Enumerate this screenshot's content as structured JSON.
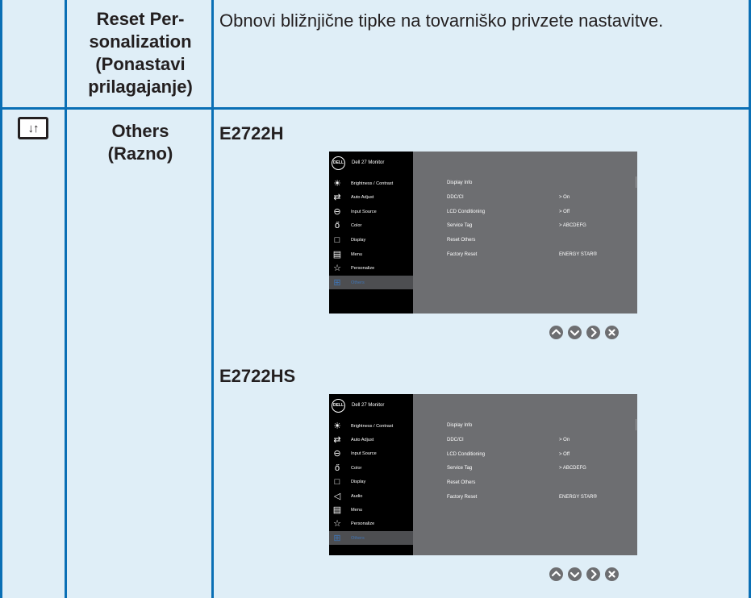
{
  "row1": {
    "name": [
      "Reset Per-",
      "sonalization",
      "(Ponastavi",
      "prilagajanje)"
    ],
    "description": "Obnovi bližnjične tipke na tovarniško privzete nastavitve."
  },
  "row2": {
    "icon": "others-sliders-icon",
    "name": [
      "Others",
      "(Razno)"
    ]
  },
  "models": [
    {
      "name": "E2722H",
      "osd": {
        "title": "Dell 27 Monitor",
        "menu": [
          {
            "icon": "brightness-icon",
            "glyph": "☀",
            "label": "Brightness / Contrast"
          },
          {
            "icon": "auto-adjust-icon",
            "glyph": "⇄",
            "label": "Auto Adjust"
          },
          {
            "icon": "input-source-icon",
            "glyph": "⊖",
            "label": "Input Source"
          },
          {
            "icon": "color-icon",
            "glyph": "ő",
            "label": "Color"
          },
          {
            "icon": "display-icon",
            "glyph": "□",
            "label": "Display"
          },
          {
            "icon": "menu-icon",
            "glyph": "▤",
            "label": "Menu"
          },
          {
            "icon": "personalize-icon",
            "glyph": "☆",
            "label": "Personalize"
          },
          {
            "icon": "others-icon",
            "glyph": "⊞",
            "label": "Others"
          }
        ],
        "items": [
          "Display Info",
          "DDC/CI",
          "LCD Conditioning",
          "Service Tag",
          "Reset Others",
          "Factory Reset"
        ],
        "values": [
          "",
          "> On",
          "> Off",
          "> ABCDEFG",
          "",
          "ENERGY STAR®"
        ]
      }
    },
    {
      "name": "E2722HS",
      "osd": {
        "title": "Dell 27 Monitor",
        "menu": [
          {
            "icon": "brightness-icon",
            "glyph": "☀",
            "label": "Brightness / Contrast"
          },
          {
            "icon": "auto-adjust-icon",
            "glyph": "⇄",
            "label": "Auto Adjust"
          },
          {
            "icon": "input-source-icon",
            "glyph": "⊖",
            "label": "Input Source"
          },
          {
            "icon": "color-icon",
            "glyph": "ő",
            "label": "Color"
          },
          {
            "icon": "display-icon",
            "glyph": "□",
            "label": "Display"
          },
          {
            "icon": "audio-icon",
            "glyph": "◁",
            "label": "Audio"
          },
          {
            "icon": "menu-icon",
            "glyph": "▤",
            "label": "Menu"
          },
          {
            "icon": "personalize-icon",
            "glyph": "☆",
            "label": "Personalize"
          },
          {
            "icon": "others-icon",
            "glyph": "⊞",
            "label": "Others"
          }
        ],
        "items": [
          "Display Info",
          "DDC/CI",
          "LCD Conditioning",
          "Service Tag",
          "Reset Others",
          "Factory Reset"
        ],
        "values": [
          "",
          "> On",
          "> Off",
          "> ABCDEFG",
          "",
          "ENERGY STAR®"
        ]
      }
    }
  ],
  "nav_buttons": [
    "up-button",
    "down-button",
    "right-button",
    "close-button"
  ],
  "colors": {
    "border": "#0a6fb5",
    "cell_bg": "#dfeef7",
    "osd_panel": "#6d6e71",
    "osd_sidebar": "#000000",
    "selected_text": "#3f74b5"
  }
}
